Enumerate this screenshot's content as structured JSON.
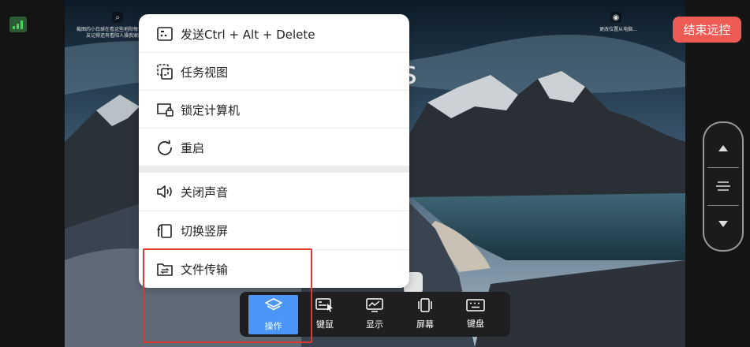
{
  "status": {
    "icon": "signal-bars-icon"
  },
  "end_button": {
    "label": "结束远控",
    "color": "#ee5a54"
  },
  "desktop": {
    "left_widget_text": "截图的小白球在看这些地阳每个小白的朋友记得还有看阳人操我家的朋...",
    "right_widget_text": "更改位置从电脑..."
  },
  "menu": {
    "items": [
      {
        "label": "发送Ctrl + Alt + Delete",
        "icon": "keyboard-shortcut-icon"
      },
      {
        "label": "任务视图",
        "icon": "task-view-icon"
      },
      {
        "label": "锁定计算机",
        "icon": "lock-computer-icon"
      },
      {
        "label": "重启",
        "icon": "restart-icon"
      },
      {
        "label": "关闭声音",
        "icon": "mute-sound-icon"
      },
      {
        "label": "切换竖屏",
        "icon": "rotate-screen-icon"
      },
      {
        "label": "文件传输",
        "icon": "file-transfer-icon"
      }
    ]
  },
  "toolbar": {
    "items": [
      {
        "label": "操作",
        "icon": "layers-icon",
        "active": true
      },
      {
        "label": "键鼠",
        "icon": "keyboard-mouse-icon",
        "active": false
      },
      {
        "label": "显示",
        "icon": "display-icon",
        "active": false
      },
      {
        "label": "屏幕",
        "icon": "screen-icon",
        "active": false
      },
      {
        "label": "键盘",
        "icon": "keyboard-icon",
        "active": false
      }
    ],
    "active_color": "#4a95f5"
  },
  "scroll_control": {
    "up_icon": "arrow-up-icon",
    "drag_icon": "drag-handle-icon",
    "down_icon": "arrow-down-icon"
  },
  "annotation": {
    "highlight_color": "#e03a2f"
  }
}
